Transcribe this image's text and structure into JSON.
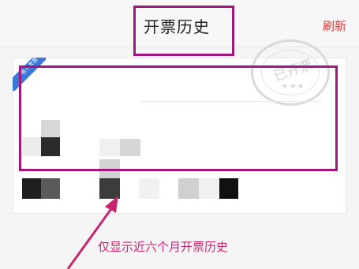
{
  "header": {
    "title": "开票历史",
    "refresh_label": "刷新"
  },
  "card": {
    "ribbon_label": "电子发票",
    "stamp_text": "已开票",
    "stamp_stars": "★★★"
  },
  "annotation": {
    "note": "仅显示近六个月开票历史"
  },
  "colors": {
    "highlight": "#a2177e",
    "accent": "#e5373b",
    "ribbon": "#3c78d8"
  }
}
